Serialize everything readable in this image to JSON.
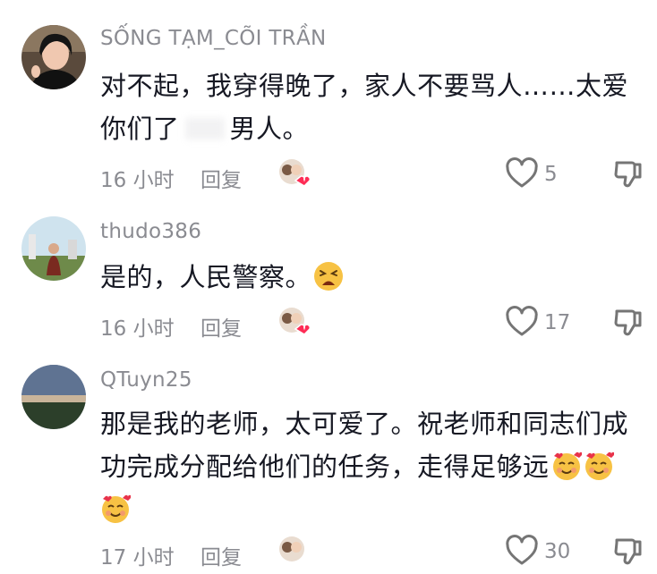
{
  "comments": [
    {
      "username": "SỐNG TẠM_CÕI TRẦN",
      "text_line1": "对不起，我穿得晚了，家人不要骂人……太爱",
      "text_line2_a": "你们了",
      "text_line2_b": "男人。",
      "time": "16 小时",
      "reply": "回复",
      "likes": "5"
    },
    {
      "username": "thudo386",
      "text": "是的，人民警察。",
      "time": "16 小时",
      "reply": "回复",
      "likes": "17"
    },
    {
      "username": "QTuyn25",
      "text_line1": "那是我的老师，太可爱了。祝老师和同志们成",
      "text_line2": "功完成分配给他们的任务，走得足够远",
      "time": "17 小时",
      "reply": "回复",
      "likes": "30"
    }
  ],
  "colors": {
    "primary_text": "#161823",
    "secondary_text": "#8a8b91",
    "icon_stroke": "#757575",
    "heart_badge": "#fe2c55"
  },
  "icons": {
    "like": "heart-outline-icon",
    "dislike": "thumbs-down-icon",
    "creator_liked": "creator-liked-badge",
    "emoji_tired": "tired-face-emoji",
    "emoji_love": "smiling-face-with-hearts-emoji"
  }
}
